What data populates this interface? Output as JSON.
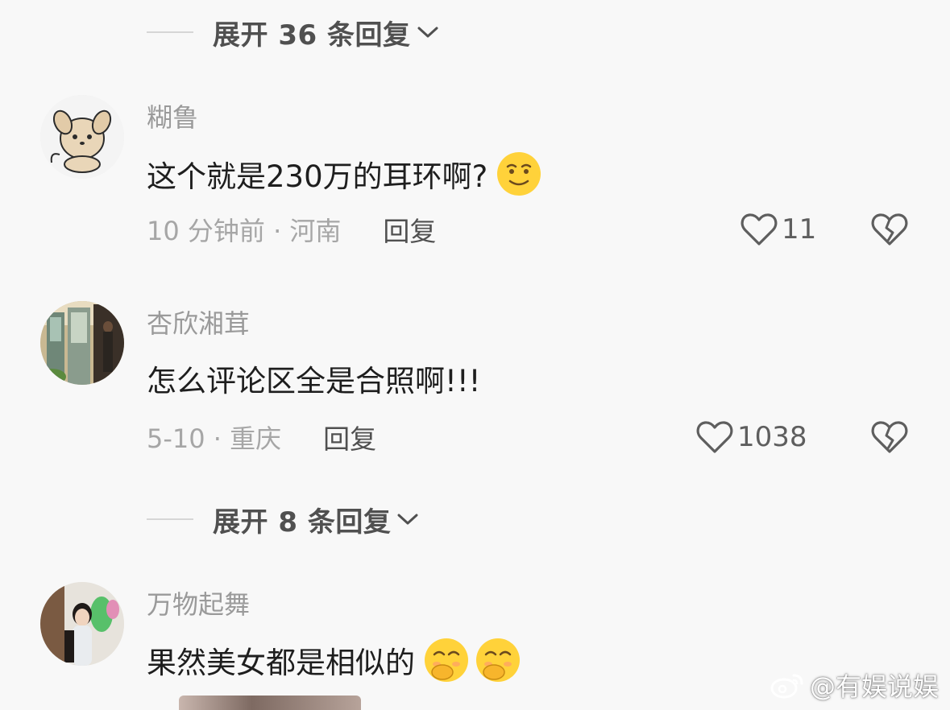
{
  "thread": {
    "expand_top": "展开 36 条回复",
    "expand_middle": "展开 8 条回复"
  },
  "comments": [
    {
      "username": "糊鲁",
      "text": "这个就是230万的耳环啊?",
      "meta": "10 分钟前 · 河南",
      "reply_label": "回复",
      "likes": "11",
      "avatar_icon": "puppy-avatar",
      "emojis": [
        "smirk-emoji"
      ]
    },
    {
      "username": "杏欣湘茸",
      "text": "怎么评论区全是合照啊!!!",
      "meta": "5-10 · 重庆",
      "reply_label": "回复",
      "likes": "1038",
      "avatar_icon": "photo-avatar",
      "emojis": []
    },
    {
      "username": "万物起舞",
      "text": "果然美女都是相似的",
      "avatar_icon": "photo-avatar",
      "emojis": [
        "giggle-emoji",
        "giggle-emoji"
      ]
    }
  ],
  "watermark": "@有娱说娱",
  "colors": {
    "background": "#f8f8f8",
    "username": "#9a9a9a",
    "text": "#1e1e1e",
    "meta": "#a6a6a6",
    "emoji": "#ffd23a"
  }
}
